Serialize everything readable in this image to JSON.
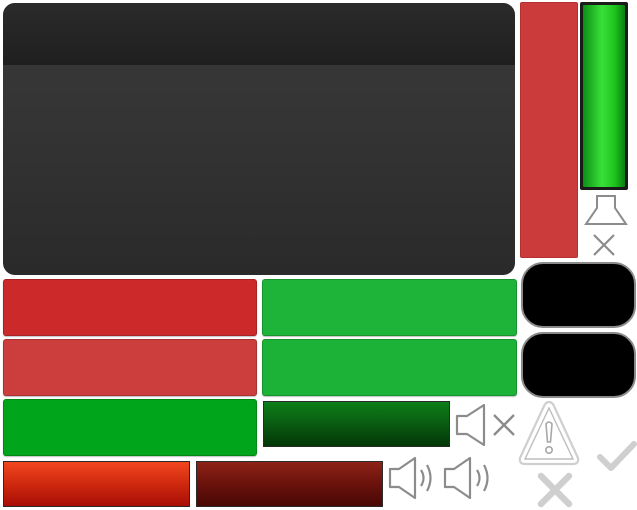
{
  "colors": {
    "panel_dark": "#333333",
    "panel_header": "#232323",
    "red_flat": "#cc2a2a",
    "red_flat_light": "#cc3e3e",
    "green_flat": "#1eb43a",
    "green_bright": "#00a51c",
    "meter_green": "#39e039",
    "dark_green": "#0a5f12",
    "orange_red": "#d22c10",
    "maroon": "#6a120c",
    "icon_gray": "#8c8c8c",
    "check_gray": "#cfcfcf"
  },
  "meter": {
    "level": 1.0
  },
  "icons": {
    "speaker_muted": "speaker-muted-icon",
    "speaker_loud": "speaker-loud-icon",
    "speaker_medium": "speaker-medium-icon",
    "warning": "warning-triangle-icon",
    "close": "close-icon",
    "check": "check-icon",
    "cross": "cross-icon",
    "speaker_stand": "speaker-stand-icon"
  }
}
